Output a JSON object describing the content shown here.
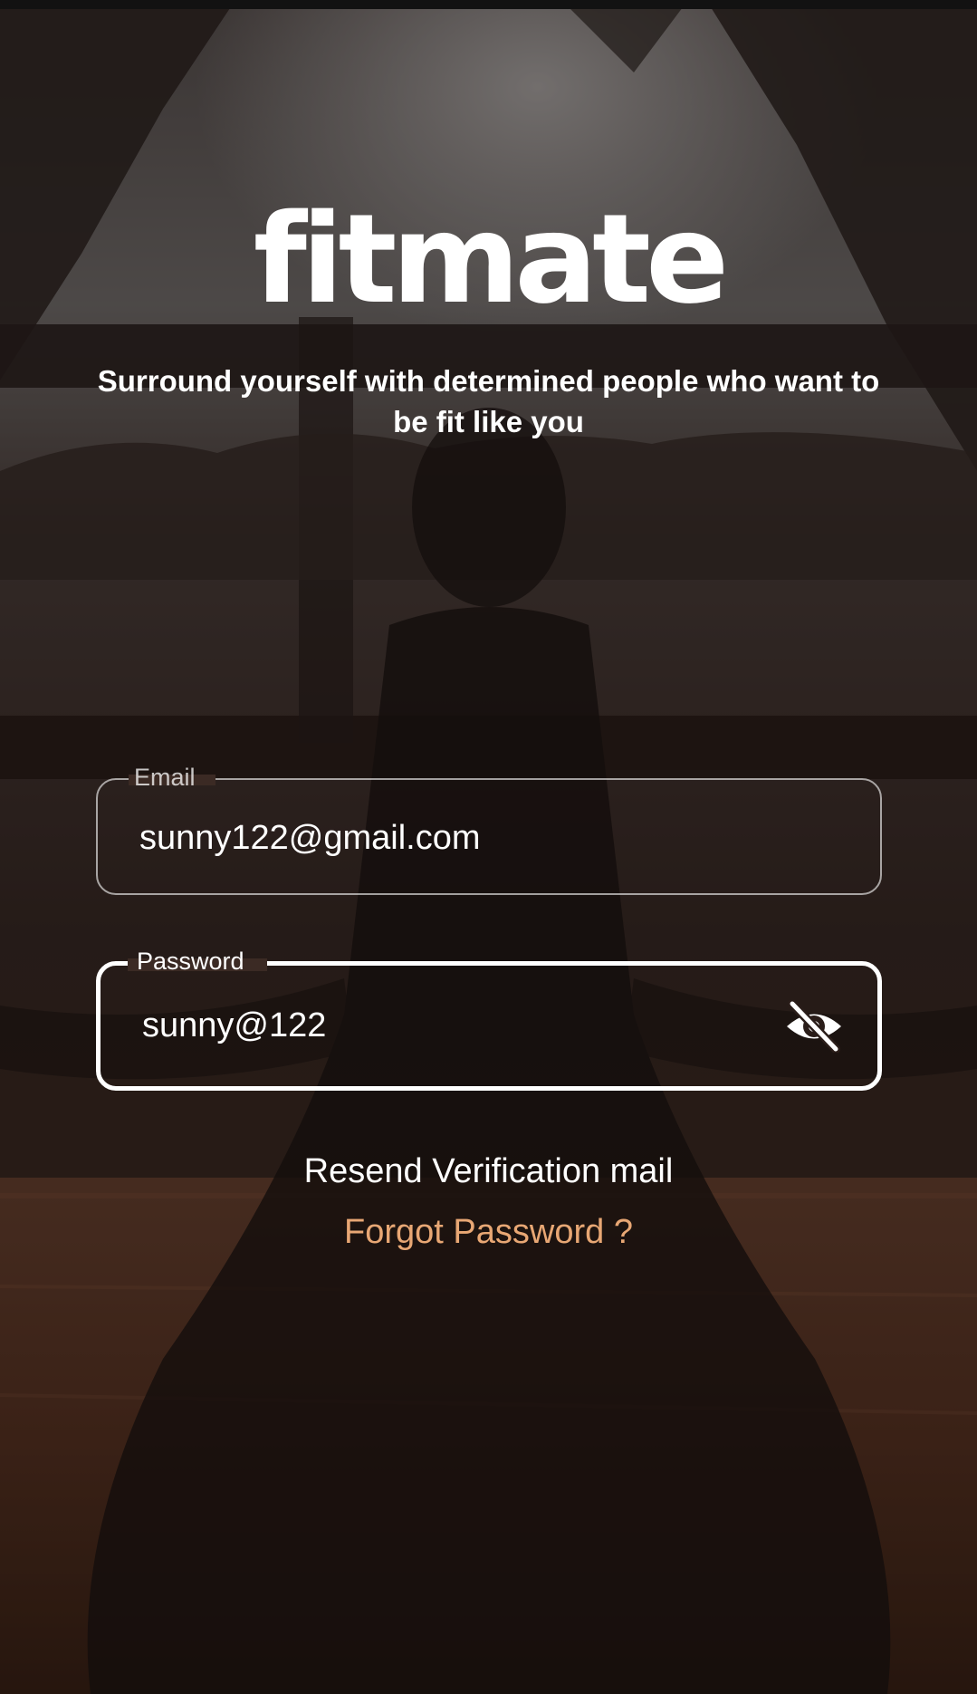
{
  "app": {
    "logo_text": "fitmate",
    "tagline": "Surround yourself with determined people who want to be fit like you"
  },
  "email_field": {
    "label": "Email",
    "value": "sunny122@gmail.com"
  },
  "password_field": {
    "label": "Password",
    "value": "sunny@122",
    "toggle_icon": "eye-off-icon"
  },
  "links": {
    "resend_verification": "Resend Verification mail",
    "forgot_password": "Forgot Password ?"
  },
  "colors": {
    "forgot_link": "#e8a774",
    "text": "#ffffff"
  }
}
